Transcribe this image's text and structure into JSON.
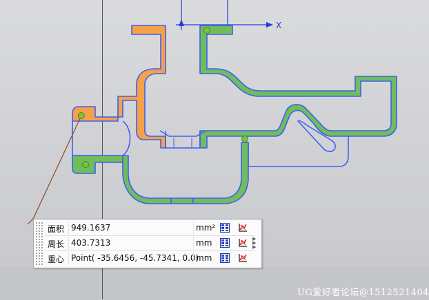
{
  "graphics": {
    "axis_x_label": "X"
  },
  "colors": {
    "background": "#d3d4d6",
    "outline": "#3f5ff0",
    "face_green": "#6fbd5b",
    "face_orange": "#f6a04a",
    "leader": "#8b4a1e",
    "point": "#7fbf3f"
  },
  "measure_panel": {
    "rows": [
      {
        "label": "面积",
        "value": "949.1637",
        "unit": "mm²"
      },
      {
        "label": "周长",
        "value": "403.7313",
        "unit": "mm"
      },
      {
        "label": "重心",
        "value": "Point( -35.6456, -45.7341, 0.0)",
        "unit": "mm"
      }
    ],
    "copy_icon": "copy-table-icon",
    "export_icon": "export-graph-icon",
    "expand_icon": "expand-arrows-icon"
  },
  "watermark": "UG爱好者论坛@1512521404"
}
